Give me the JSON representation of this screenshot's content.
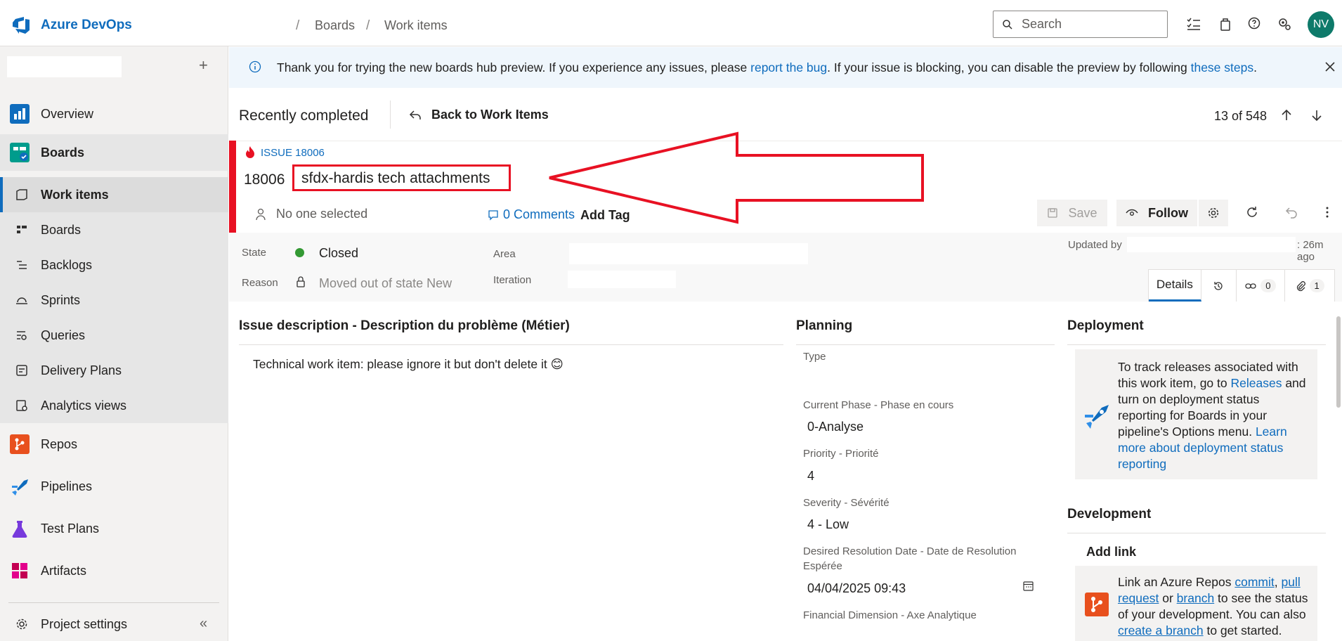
{
  "app": {
    "name": "Azure DevOps",
    "accent": "#0f6cbd"
  },
  "breadcrumb": [
    {
      "label": "Boards"
    },
    {
      "label": "Work items"
    }
  ],
  "search": {
    "placeholder": "Search"
  },
  "user": {
    "initials": "NV"
  },
  "sidebar": {
    "top_items": [
      {
        "label": "Overview",
        "icon": "overview-icon"
      },
      {
        "label": "Boards",
        "icon": "boards-icon"
      }
    ],
    "board_sub_items": [
      {
        "label": "Work items",
        "icon": "work-items-icon"
      },
      {
        "label": "Boards",
        "icon": "kanban-icon"
      },
      {
        "label": "Backlogs",
        "icon": "backlogs-icon"
      },
      {
        "label": "Sprints",
        "icon": "sprints-icon"
      },
      {
        "label": "Queries",
        "icon": "queries-icon"
      },
      {
        "label": "Delivery Plans",
        "icon": "delivery-plans-icon"
      },
      {
        "label": "Analytics views",
        "icon": "analytics-icon"
      }
    ],
    "other_items": [
      {
        "label": "Repos",
        "icon": "repos-icon"
      },
      {
        "label": "Pipelines",
        "icon": "pipelines-icon"
      },
      {
        "label": "Test Plans",
        "icon": "test-plans-icon"
      },
      {
        "label": "Artifacts",
        "icon": "artifacts-icon"
      }
    ],
    "settings_label": "Project settings"
  },
  "banner": {
    "text_1": "Thank you for trying the new boards hub preview. If you experience any issues, please ",
    "link_1": "report the bug",
    "text_2": ". If your issue is blocking, you can disable the preview by following ",
    "link_2": "these steps",
    "text_3": "."
  },
  "header": {
    "title": "Recently completed",
    "back_label": "Back to Work Items",
    "counter": "13 of 548"
  },
  "work_item": {
    "type_label": "ISSUE 18006",
    "id": "18006",
    "title": "sfdx-hardis tech attachments",
    "assignee": "No one selected",
    "comments": "0 Comments",
    "add_tag": "Add Tag",
    "save_label": "Save",
    "follow_label": "Follow",
    "updated_by_label": "Updated by",
    "updated_ago": ": 26m ago"
  },
  "fields": {
    "state_label": "State",
    "state_value": "Closed",
    "state_color": "#339933",
    "reason_label": "Reason",
    "reason_value": "Moved out of state New",
    "area_label": "Area",
    "iteration_label": "Iteration"
  },
  "tabs": {
    "details": "Details",
    "links_count": "0",
    "attachments_count": "1"
  },
  "description": {
    "title": "Issue description - Description du problème (Métier)",
    "text": "Technical work item: please ignore it but don't delete it 😊"
  },
  "planning": {
    "title": "Planning",
    "type_label": "Type",
    "phase_label": "Current Phase - Phase en cours",
    "phase_value": "0-Analyse",
    "priority_label": "Priority - Priorité",
    "priority_value": "4",
    "severity_label": "Severity - Sévérité",
    "severity_value": "4 - Low",
    "date_label_1": "Desired Resolution Date - Date de Resolution",
    "date_label_2": "Espérée",
    "date_value": "04/04/2025 09:43",
    "financial_label": "Financial Dimension - Axe Analytique"
  },
  "deployment": {
    "title": "Deployment",
    "text_1": "To track releases associated with this work item, go to ",
    "link_releases": "Releases",
    "text_2": " and turn on deployment status reporting for Boards in your pipeline's Options menu. ",
    "link_learn": "Learn more about deployment status reporting"
  },
  "development": {
    "title": "Development",
    "add_link": "Add link",
    "t1": "Link an Azure Repos ",
    "l_commit": "commit",
    "t2": ", ",
    "l_pr": "pull request",
    "t3": " or ",
    "l_branch": "branch",
    "t4": " to see the status of your development. You can also ",
    "l_create": "create a branch",
    "t5": " to get started."
  }
}
